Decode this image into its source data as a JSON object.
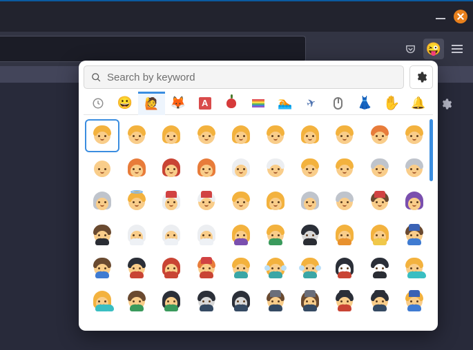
{
  "window": {
    "minimize_label": "Minimize",
    "close_label": "Close"
  },
  "toolbar": {
    "pocket_label": "Save to Pocket",
    "emoji_ext_label": "Emoji picker extension",
    "emoji_ext_glyph": "😜",
    "menu_label": "Open application menu"
  },
  "page": {
    "settings_label": "Page settings"
  },
  "picker": {
    "search": {
      "placeholder": "Search by keyword",
      "value": ""
    },
    "settings_label": "Picker settings",
    "categories": [
      {
        "id": "recent",
        "label": "Recently used",
        "selected": false
      },
      {
        "id": "smileys",
        "label": "Smileys",
        "selected": false
      },
      {
        "id": "people",
        "label": "People",
        "selected": true
      },
      {
        "id": "animals",
        "label": "Animals",
        "selected": false
      },
      {
        "id": "symbols",
        "label": "Symbols",
        "selected": false
      },
      {
        "id": "food",
        "label": "Food",
        "selected": false
      },
      {
        "id": "flags",
        "label": "Flags",
        "selected": false
      },
      {
        "id": "activity",
        "label": "Activity",
        "selected": false
      },
      {
        "id": "travel",
        "label": "Travel",
        "selected": false
      },
      {
        "id": "objects",
        "label": "Objects",
        "selected": false
      },
      {
        "id": "clothing",
        "label": "Clothing",
        "selected": false
      },
      {
        "id": "body",
        "label": "Body",
        "selected": false
      },
      {
        "id": "misc",
        "label": "Misc",
        "selected": false
      }
    ],
    "selected_emoji": "baby",
    "grid": [
      [
        "baby",
        "child",
        "girl",
        "boy",
        "woman-blond",
        "man-blond",
        "woman-blond-2",
        "man-blond-2",
        "man-red",
        "man-blond-3"
      ],
      [
        "man-bald",
        "woman-red",
        "woman-red-2",
        "woman-orange",
        "woman-white",
        "man-white",
        "woman-blond-short",
        "man-blond-short",
        "person-grey",
        "older-man"
      ],
      [
        "older-woman",
        "angel",
        "mrs-claus",
        "santa",
        "man-gesture",
        "woman-shrug",
        "woman-grey",
        "man-grey",
        "worker",
        "woman-headscarf"
      ],
      [
        "man-tux",
        "bride",
        "bride-2",
        "person-white",
        "mother-baby",
        "father-baby",
        "ninja",
        "woman-kneel",
        "mother-feed",
        "police"
      ],
      [
        "superhero",
        "vampire-m",
        "vampire-f",
        "mage",
        "mage-wand",
        "fairy",
        "fairy-2",
        "vampire-w",
        "vampire-bl",
        "merman"
      ],
      [
        "mermaid",
        "elf",
        "elf-f",
        "zombie",
        "zombie-f",
        "detective-m",
        "detective-f",
        "guard-r",
        "guard-bl",
        "officer"
      ]
    ],
    "emoji_meta": {
      "baby": {
        "hair": "hr-b",
        "skin": "sk-d",
        "long": false
      },
      "child": {
        "hair": "hr-b",
        "skin": "sk-d",
        "long": false
      },
      "girl": {
        "hair": "hr-b",
        "skin": "sk-d",
        "long": true
      },
      "boy": {
        "hair": "hr-b",
        "skin": "sk-d",
        "long": false
      },
      "woman-blond": {
        "hair": "hr-b",
        "skin": "sk-d",
        "long": true
      },
      "man-blond": {
        "hair": "hr-b",
        "skin": "sk-d",
        "long": false
      },
      "woman-blond-2": {
        "hair": "hr-b",
        "skin": "sk-d",
        "long": true
      },
      "man-blond-2": {
        "hair": "hr-b",
        "skin": "sk-d",
        "long": false
      },
      "man-red": {
        "hair": "hr-o",
        "skin": "sk-d",
        "long": false
      },
      "man-blond-3": {
        "hair": "hr-b",
        "skin": "sk-d",
        "long": false
      },
      "man-bald": {
        "hair": "",
        "skin": "sk-d",
        "long": false
      },
      "woman-red": {
        "hair": "hr-o",
        "skin": "sk-d",
        "long": true
      },
      "woman-red-2": {
        "hair": "hr-r",
        "skin": "sk-d",
        "long": true
      },
      "woman-orange": {
        "hair": "hr-o",
        "skin": "sk-d",
        "long": true
      },
      "woman-white": {
        "hair": "hr-w",
        "skin": "sk-d",
        "long": true
      },
      "man-white": {
        "hair": "hr-w",
        "skin": "sk-d",
        "long": false
      },
      "woman-blond-short": {
        "hair": "hr-b",
        "skin": "sk-d",
        "long": false
      },
      "man-blond-short": {
        "hair": "hr-b",
        "skin": "sk-d",
        "long": false
      },
      "person-grey": {
        "hair": "hr-g",
        "skin": "sk-d",
        "long": false
      },
      "older-man": {
        "hair": "hr-g",
        "skin": "sk-d",
        "long": false
      },
      "older-woman": {
        "hair": "hr-g",
        "skin": "sk-d",
        "long": true
      },
      "angel": {
        "hair": "hr-b",
        "skin": "sk-d",
        "long": false,
        "extra": "halo"
      },
      "mrs-claus": {
        "hair": "hr-w",
        "skin": "sk-d",
        "long": true,
        "hat": "red"
      },
      "santa": {
        "hair": "hr-w",
        "skin": "sk-d",
        "long": false,
        "hat": "red"
      },
      "man-gesture": {
        "hair": "hr-b",
        "skin": "sk-d",
        "long": false
      },
      "woman-shrug": {
        "hair": "hr-b",
        "skin": "sk-d",
        "long": true
      },
      "woman-grey": {
        "hair": "hr-g",
        "skin": "sk-d",
        "long": true
      },
      "man-grey": {
        "hair": "hr-g",
        "skin": "sk-d",
        "long": false
      },
      "worker": {
        "hair": "hr-br",
        "skin": "sk-d",
        "long": false,
        "hat": "red"
      },
      "woman-headscarf": {
        "hair": "hr-p",
        "skin": "sk-d",
        "long": true
      },
      "man-tux": {
        "hair": "hr-br",
        "skin": "sk-d",
        "body": "bd-k"
      },
      "bride": {
        "hair": "hr-w",
        "skin": "sk-d",
        "long": true,
        "body": "bd-w"
      },
      "bride-2": {
        "hair": "hr-w",
        "skin": "sk-d",
        "long": true,
        "body": "bd-w"
      },
      "person-white": {
        "hair": "hr-w",
        "skin": "sk-d",
        "long": true,
        "body": "bd-w"
      },
      "mother-baby": {
        "hair": "hr-b",
        "skin": "sk-d",
        "long": true,
        "body": "bd-p"
      },
      "father-baby": {
        "hair": "hr-b",
        "skin": "sk-d",
        "body": "bd-g"
      },
      "ninja": {
        "hair": "hr-bl",
        "skin": "sk-g",
        "body": "bd-k"
      },
      "woman-kneel": {
        "hair": "hr-b",
        "skin": "sk-d",
        "long": true,
        "body": "bd-o"
      },
      "mother-feed": {
        "hair": "hr-b",
        "skin": "sk-d",
        "long": true,
        "body": "bd-y"
      },
      "police": {
        "hair": "hr-br",
        "skin": "sk-d",
        "body": "bd-blue",
        "hat": "blu"
      },
      "superhero": {
        "hair": "hr-br",
        "skin": "sk-d",
        "body": "bd-blue"
      },
      "vampire-m": {
        "hair": "hr-bl",
        "skin": "sk-d",
        "body": "bd-r"
      },
      "vampire-f": {
        "hair": "hr-r",
        "skin": "sk-d",
        "long": true,
        "body": "bd-r"
      },
      "mage": {
        "hair": "hr-o",
        "skin": "sk-d",
        "body": "bd-r",
        "hat": "red"
      },
      "mage-wand": {
        "hair": "hr-b",
        "skin": "sk-d",
        "body": "bd-t"
      },
      "fairy": {
        "hair": "hr-b",
        "skin": "sk-d",
        "long": true,
        "body": "bd-t",
        "extra": "wings"
      },
      "fairy-2": {
        "hair": "hr-b",
        "skin": "sk-d",
        "body": "bd-t",
        "extra": "wings"
      },
      "vampire-w": {
        "hair": "hr-bl",
        "skin": "sk-l",
        "long": true,
        "body": "bd-r"
      },
      "vampire-bl": {
        "hair": "hr-bl",
        "skin": "sk-l",
        "body": "bd-k"
      },
      "merman": {
        "hair": "hr-b",
        "skin": "sk-d",
        "body": "bd-sea",
        "extra": "fin"
      },
      "mermaid": {
        "hair": "hr-b",
        "skin": "sk-d",
        "long": true,
        "body": "bd-sea",
        "extra": "fin"
      },
      "elf": {
        "hair": "hr-br",
        "skin": "sk-d",
        "body": "bd-g"
      },
      "elf-f": {
        "hair": "hr-bl",
        "skin": "sk-d",
        "long": true,
        "body": "bd-g"
      },
      "zombie": {
        "hair": "hr-bl",
        "skin": "sk-g",
        "body": "bd-bl"
      },
      "zombie-f": {
        "hair": "hr-bl",
        "skin": "sk-g",
        "long": true,
        "body": "bd-bl"
      },
      "detective-m": {
        "hair": "hr-br",
        "skin": "sk-d",
        "body": "bd-bl",
        "hat": "gry"
      },
      "detective-f": {
        "hair": "hr-br",
        "skin": "sk-d",
        "long": true,
        "body": "bd-bl",
        "hat": "gry"
      },
      "guard-r": {
        "hair": "hr-bl",
        "skin": "sk-d",
        "body": "bd-r",
        "hat": "blk"
      },
      "guard-bl": {
        "hair": "hr-bl",
        "skin": "sk-d",
        "body": "bd-bl",
        "hat": "blk"
      },
      "officer": {
        "hair": "hr-b",
        "skin": "sk-d",
        "body": "bd-blue",
        "hat": "blu"
      }
    }
  }
}
